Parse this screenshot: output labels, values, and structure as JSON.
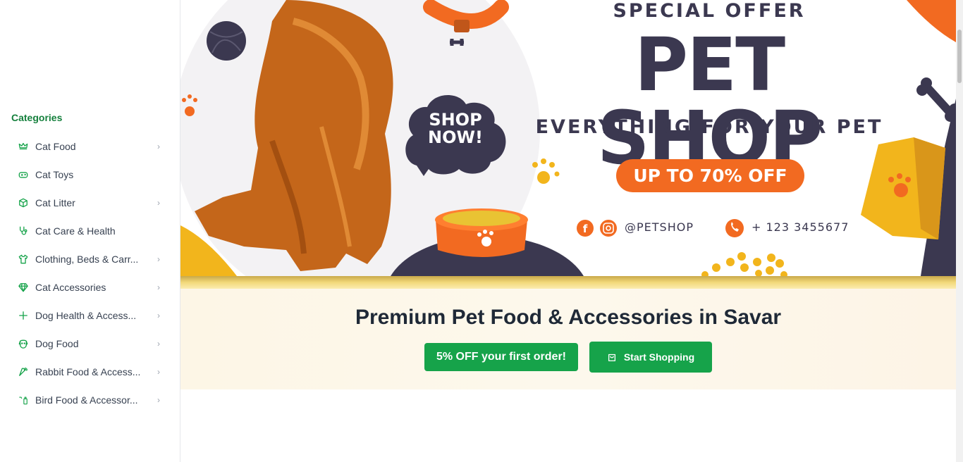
{
  "sidebar": {
    "title": "Categories",
    "items": [
      {
        "label": "Cat Food",
        "icon": "crown-icon",
        "has_children": true
      },
      {
        "label": "Cat Toys",
        "icon": "gamepad-icon",
        "has_children": false
      },
      {
        "label": "Cat Litter",
        "icon": "box-icon",
        "has_children": true
      },
      {
        "label": "Cat Care & Health",
        "icon": "stethoscope-icon",
        "has_children": false
      },
      {
        "label": "Clothing, Beds & Carr...",
        "icon": "shirt-icon",
        "has_children": true
      },
      {
        "label": "Cat Accessories",
        "icon": "gem-icon",
        "has_children": true
      },
      {
        "label": "Dog Health & Access...",
        "icon": "plus-icon",
        "has_children": true
      },
      {
        "label": "Dog Food",
        "icon": "dog-face-icon",
        "has_children": true
      },
      {
        "label": "Rabbit Food & Access...",
        "icon": "carrot-icon",
        "has_children": true
      },
      {
        "label": "Bird Food & Accessor...",
        "icon": "bird-bottle-icon",
        "has_children": true
      }
    ]
  },
  "banner": {
    "special_offer": "SPECIAL OFFER",
    "headline": "PET SHOP",
    "tagline": "EVERYTHING FOR YOUR PET",
    "sale": "UP TO 70% OFF",
    "shop_now_line1": "SHOP",
    "shop_now_line2": "NOW!",
    "handle": "@PETSHOP",
    "phone": "+ 123 3455677",
    "colors": {
      "orange": "#f26a21",
      "navy": "#3b3850",
      "yellow": "#f2b51c"
    }
  },
  "hero": {
    "title": "Premium Pet Food & Accessories in Savar",
    "offer_button": "5% OFF your first order!",
    "start_button": "Start Shopping",
    "accent": "#16a34a"
  }
}
